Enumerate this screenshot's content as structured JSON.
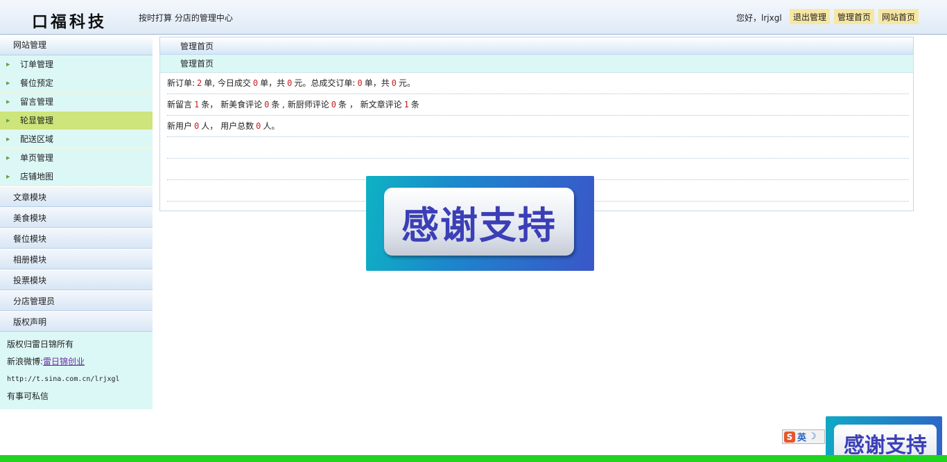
{
  "header": {
    "logo": "口福科技",
    "subtitle": "按时打算 分店的管理中心",
    "greeting": "您好，lrjxgl",
    "links": [
      "退出管理",
      "管理首页",
      "网站首页"
    ]
  },
  "sidebar": {
    "head": "网站管理",
    "items": [
      {
        "label": "订单管理",
        "active": false
      },
      {
        "label": "餐位预定",
        "active": false
      },
      {
        "label": "留言管理",
        "active": false
      },
      {
        "label": "轮显管理",
        "active": true
      },
      {
        "label": "配送区域",
        "active": false
      },
      {
        "label": "单页管理",
        "active": false
      },
      {
        "label": "店铺地图",
        "active": false
      }
    ],
    "modules": [
      "文章模块",
      "美食模块",
      "餐位模块",
      "相册模块",
      "投票模块",
      "分店管理员",
      "版权声明"
    ],
    "info": {
      "copyright": "版权归雷日锦所有",
      "weibo_prefix": "新浪微博:",
      "weibo_link": "雷日锦创业",
      "url": "http://t.sina.com.cn/lrjxgl",
      "contact": "有事可私信"
    }
  },
  "main": {
    "bar1": "管理首页",
    "bar2": "管理首页",
    "row1": {
      "p1": "新订单:",
      "v1": "2",
      "p2": "单, 今日成交",
      "v2": "0",
      "p3": "单，共",
      "v3": "0",
      "p4": "元。总成交订单:",
      "v4": "0",
      "p5": "单，共",
      "v5": "0",
      "p6": "元。"
    },
    "row2": {
      "p1": "新留言",
      "v1": "1",
      "p2": "条， 新美食评论",
      "v2": "0",
      "p3": "条 , 新厨师评论",
      "v3": "0",
      "p4": "条 ， 新文章评论",
      "v4": "1",
      "p5": "条"
    },
    "row3": {
      "p1": "新用户",
      "v1": "0",
      "p2": "人， 用户总数",
      "v2": "0",
      "p3": "人。"
    }
  },
  "banner": {
    "text": "感谢支持"
  },
  "ime": {
    "s": "S",
    "lang": "英",
    "moon": "☽"
  }
}
